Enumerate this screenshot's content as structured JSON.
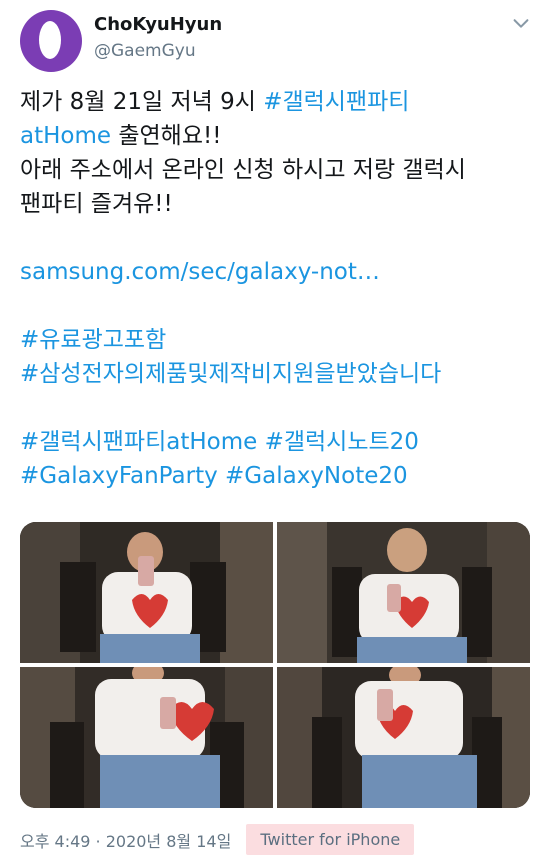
{
  "tweet": {
    "author_name": "ChoKyuHyun",
    "author_handle": "@GaemGyu",
    "lines": [
      {
        "segments": [
          {
            "text": "제가 8월 21일 저녁 9시 ",
            "kind": "text"
          },
          {
            "text": "#갤럭시팬파티",
            "kind": "tag"
          }
        ]
      },
      {
        "segments": [
          {
            "text": "atHome",
            "kind": "tag"
          },
          {
            "text": " 출연해요!!",
            "kind": "text"
          }
        ]
      },
      {
        "segments": [
          {
            "text": "아래 주소에서 온라인 신청 하시고 저랑 갤럭시",
            "kind": "text"
          }
        ]
      },
      {
        "segments": [
          {
            "text": "팬파티 즐겨유!!",
            "kind": "text"
          }
        ]
      },
      {
        "segments": []
      },
      {
        "segments": [
          {
            "text": "samsung.com/sec/galaxy-not…",
            "kind": "link"
          }
        ]
      },
      {
        "segments": []
      },
      {
        "segments": [
          {
            "text": "#유료광고포함",
            "kind": "tag"
          }
        ]
      },
      {
        "segments": [
          {
            "text": "#삼성전자의제품및제작비지원을받았습니다",
            "kind": "tag"
          }
        ]
      },
      {
        "segments": []
      },
      {
        "segments": [
          {
            "text": "#갤럭시팬파티atHome",
            "kind": "tag"
          },
          {
            "text": " ",
            "kind": "text"
          },
          {
            "text": "#갤럭시노트20",
            "kind": "tag"
          }
        ]
      },
      {
        "segments": [
          {
            "text": "#GalaxyFanParty",
            "kind": "tag"
          },
          {
            "text": " ",
            "kind": "text"
          },
          {
            "text": "#GalaxyNote20",
            "kind": "tag"
          }
        ]
      }
    ],
    "timestamp": "오후 4:49 · 2020년 8월 14일",
    "source": "Twitter for iPhone"
  },
  "icons": {
    "avatar": "avatar-icon",
    "menu": "chevron-down-icon"
  },
  "colors": {
    "link": "#1b95e0",
    "muted": "#657786",
    "avatar": "#7b3db4",
    "source_highlight": "#fbdde0"
  }
}
